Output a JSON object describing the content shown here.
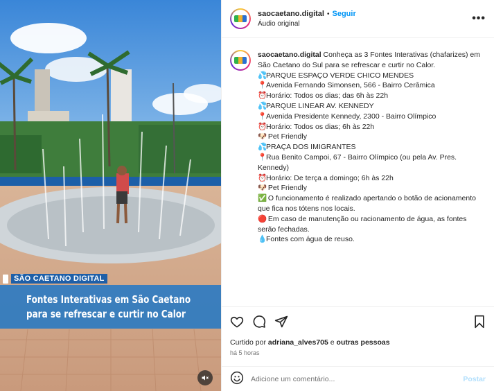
{
  "media": {
    "brand_label": "SÃO CAETANO DIGITAL",
    "caption_line1": "Fontes Interativas em São Caetano",
    "caption_line2": "para se refrescar e curtir no Calor",
    "mute_icon": "speaker-muted-icon"
  },
  "header": {
    "username": "saocaetano.digital",
    "separator": "•",
    "follow_label": "Seguir",
    "audio_label": "Áudio original",
    "more_label": "•••"
  },
  "caption": {
    "username": "saocaetano.digital",
    "intro": " Conheça as 3 Fontes Interativas (chafarizes) em São Caetano do Sul para se refrescar e curtir no Calor.",
    "places": [
      {
        "name": "PARQUE ESPAÇO VERDE CHICO MENDES",
        "address": "Avenida Fernando Simonsen, 566 - Bairro Cerâmica",
        "hours": "Horário: Todos os dias; das 6h às 22h",
        "pet": ""
      },
      {
        "name": "PARQUE LINEAR AV. KENNEDY",
        "address": "Avenida Presidente Kennedy, 2300 - Bairro Olímpico",
        "hours": "Horário: Todos os dias; 6h às 22h",
        "pet": "Pet Friendly"
      },
      {
        "name": "PRAÇA DOS IMIGRANTES",
        "address": "Rua Benito Campoi, 67 - Bairro Olímpico (ou pela Av. Pres. Kennedy)",
        "hours": "Horário: De terça a domingo; 6h às 22h",
        "pet": "Pet Friendly"
      }
    ],
    "note_operation": "O funcionamento é realizado apertando o botão de acionamento que fica nos tótens nos locais.",
    "note_maintenance": "Em caso de manutenção ou racionamento de água, as fontes serão fechadas.",
    "note_water": "Fontes com água de reuso.",
    "icons": {
      "droplets": "💦",
      "pin": "📍",
      "clock": "⏰",
      "dog": "🐶",
      "check": "✅",
      "red_circle": "🔴",
      "droplet": "💧"
    }
  },
  "actions": {
    "like_icon": "heart-icon",
    "comment_icon": "comment-icon",
    "share_icon": "share-icon",
    "save_icon": "bookmark-icon"
  },
  "likes": {
    "prefix": "Curtido por ",
    "user": "adriana_alves705",
    "middle": " e ",
    "others": "outras pessoas"
  },
  "time_label": "há 5 horas",
  "comment": {
    "placeholder": "Adicione um comentário...",
    "post_label": "Postar"
  },
  "colors": {
    "accent": "#0095f6",
    "caption_band": "#2679c4"
  }
}
